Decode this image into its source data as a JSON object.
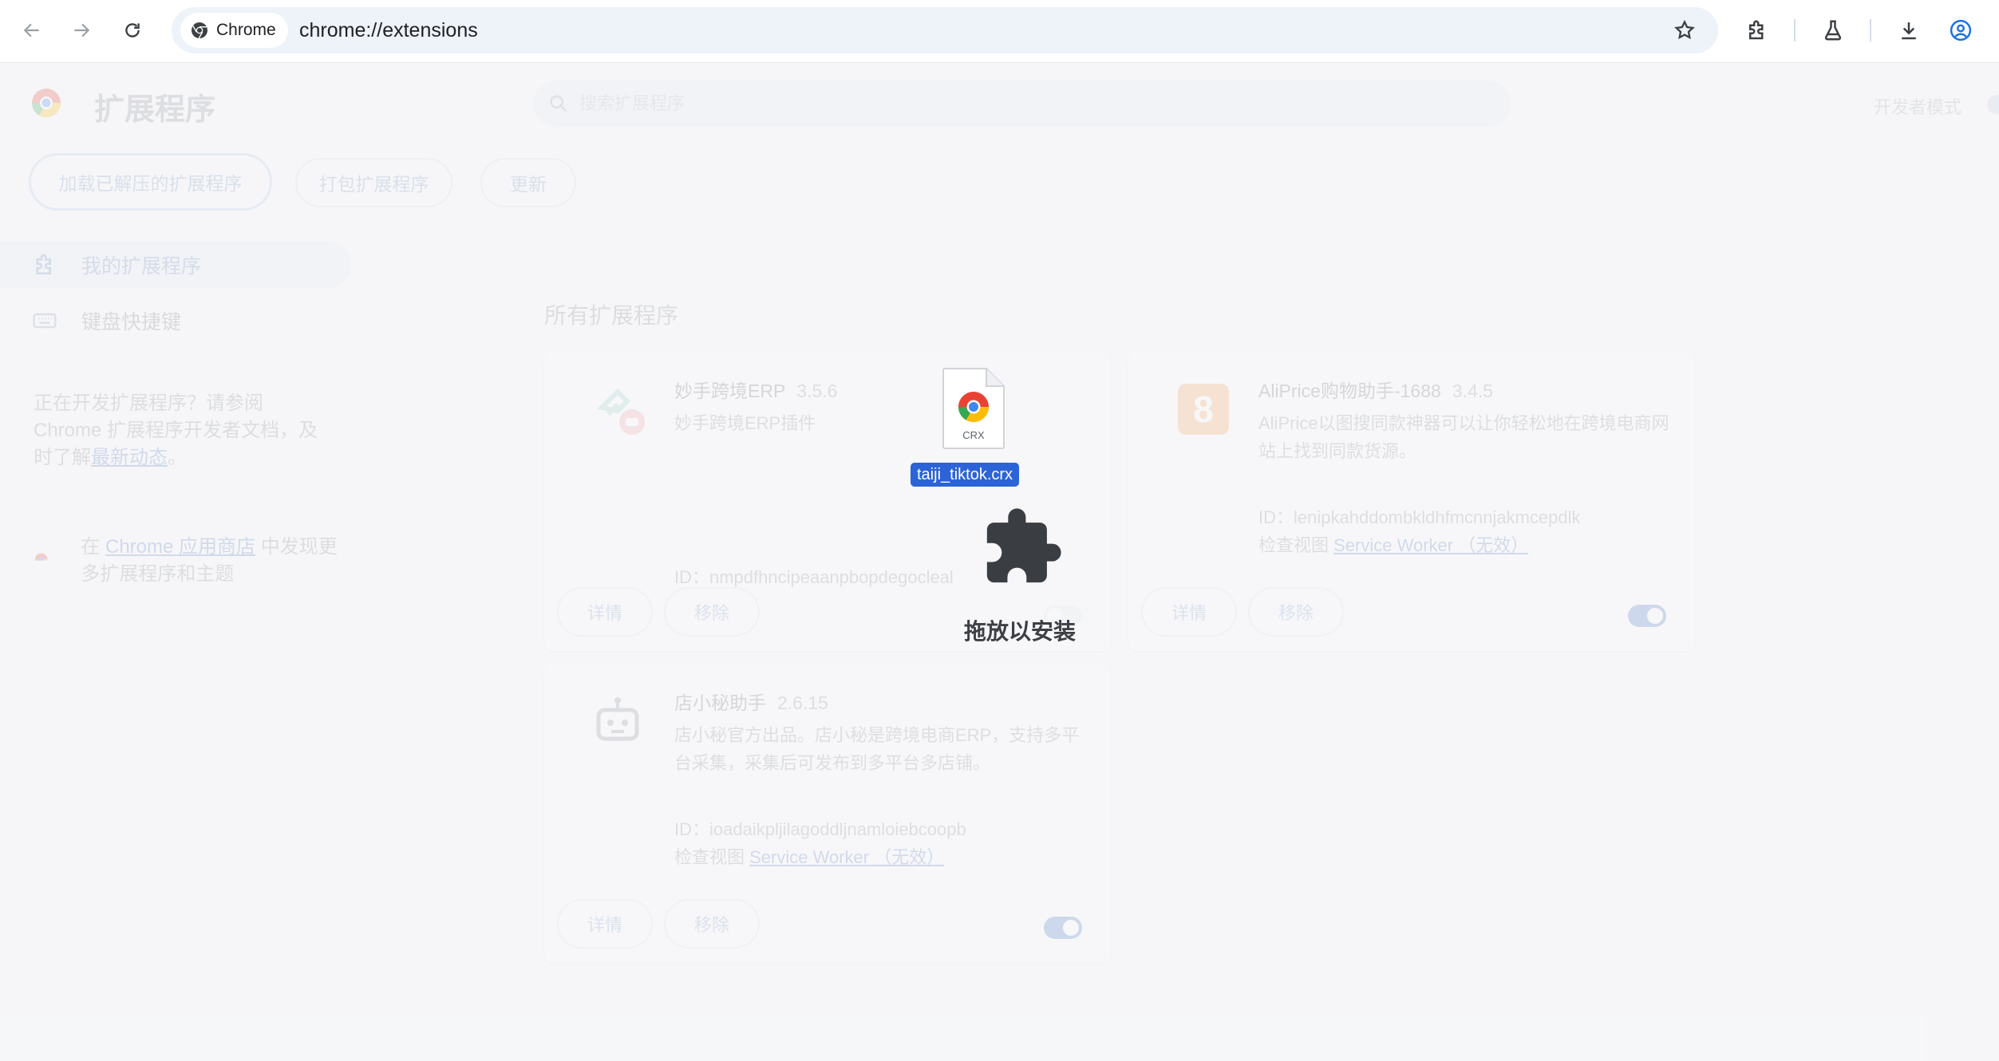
{
  "toolbar": {
    "chip_label": "Chrome",
    "url": "chrome://extensions"
  },
  "page": {
    "title": "扩展程序",
    "search_placeholder": "搜索扩展程序",
    "dev_mode_label": "开发者模式",
    "buttons": {
      "load_unpacked": "加载已解压的扩展程序",
      "pack": "打包扩展程序",
      "update": "更新"
    }
  },
  "sidebar": {
    "items": [
      {
        "label": "我的扩展程序"
      },
      {
        "label": "键盘快捷键"
      }
    ],
    "dev_text_prefix": "正在开发扩展程序？请参阅 Chrome 扩展程序开发者文档，及时了解",
    "dev_text_link": "最新动态",
    "dev_text_suffix": "。",
    "store_prefix": "在 ",
    "store_link": "Chrome 应用商店",
    "store_suffix": " 中发现更多扩展程序和主题"
  },
  "main": {
    "section_title": "所有扩展程序",
    "cards": [
      {
        "name": "妙手跨境ERP",
        "version": "3.5.6",
        "description": "妙手跨境ERP插件",
        "id_text": "ID：nmpdfhncipeaanpbopdegocleal",
        "details_label": "详情",
        "remove_label": "移除"
      },
      {
        "name": "AliPrice购物助手-1688",
        "version": "3.4.5",
        "description": "AliPrice以图搜同款神器可以让你轻松地在跨境电商网站上找到同款货源。",
        "id_text": "ID：lenipkahddombkldhfmcnnjakmcepdlk",
        "inspect_prefix": "检查视图 ",
        "inspect_link": "Service Worker （无效）",
        "details_label": "详情",
        "remove_label": "移除",
        "enabled": true
      },
      {
        "name": "店小秘助手",
        "version": "2.6.15",
        "description": "店小秘官方出品。店小秘是跨境电商ERP，支持多平台采集，采集后可发布到多平台多店铺。",
        "id_text": "ID：ioadaikpljilagoddljnamloiebcoopb",
        "inspect_prefix": "检查视图 ",
        "inspect_link": "Service Worker （无效）",
        "details_label": "详情",
        "remove_label": "移除",
        "enabled": true
      }
    ]
  },
  "drag": {
    "file_name": "taiji_tiktok.crx",
    "file_type": "CRX",
    "drop_label": "拖放以安装"
  },
  "colors": {
    "accent": "#4d79c6",
    "selection": "#2c63d6"
  }
}
